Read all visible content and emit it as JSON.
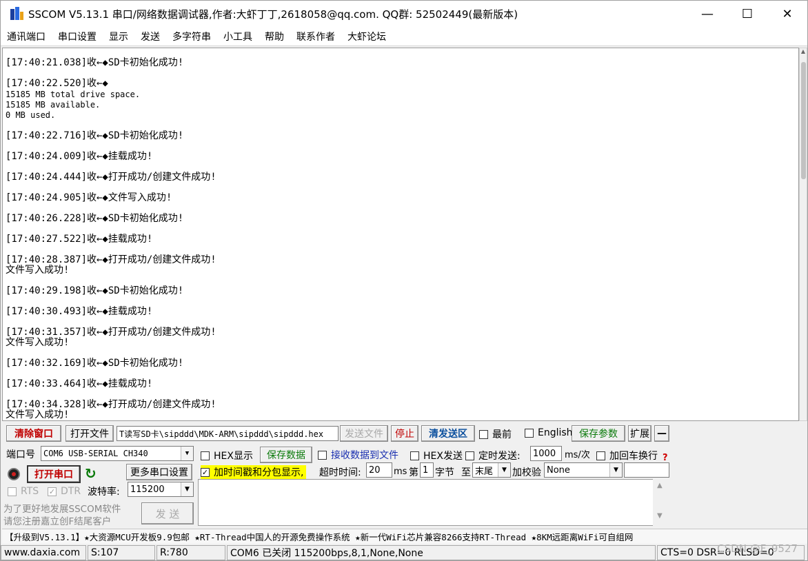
{
  "window": {
    "title": "SSCOM V5.13.1 串口/网络数据调试器,作者:大虾丁丁,2618058@qq.com. QQ群: 52502449(最新版本)",
    "minimize": "—",
    "maximize": "☐",
    "close": "✕"
  },
  "menu": [
    "通讯端口",
    "串口设置",
    "显示",
    "发送",
    "多字符串",
    "小工具",
    "帮助",
    "联系作者",
    "大虾论坛"
  ],
  "receive_log": [
    {
      "text": "[17:40:21.038]收←◆SD卡初始化成功!"
    },
    {
      "text": "[17:40:22.520]收←◆"
    },
    {
      "text": "15185 MB total drive space.",
      "small": true
    },
    {
      "text": "15185 MB available.",
      "small": true
    },
    {
      "text": "0 MB  used.",
      "small": true
    },
    {
      "text": "[17:40:22.716]收←◆SD卡初始化成功!"
    },
    {
      "text": "[17:40:24.009]收←◆挂载成功!"
    },
    {
      "text": "[17:40:24.444]收←◆打开成功/创建文件成功!"
    },
    {
      "text": "[17:40:24.905]收←◆文件写入成功!"
    },
    {
      "text": "[17:40:26.228]收←◆SD卡初始化成功!"
    },
    {
      "text": "[17:40:27.522]收←◆挂载成功!"
    },
    {
      "text": "[17:40:28.387]收←◆打开成功/创建文件成功!"
    },
    {
      "text": "文件写入成功!"
    },
    {
      "text": "[17:40:29.198]收←◆SD卡初始化成功!"
    },
    {
      "text": "[17:40:30.493]收←◆挂载成功!"
    },
    {
      "text": "[17:40:31.357]收←◆打开成功/创建文件成功!"
    },
    {
      "text": "文件写入成功!"
    },
    {
      "text": "[17:40:32.169]收←◆SD卡初始化成功!"
    },
    {
      "text": "[17:40:33.464]收←◆挂载成功!"
    },
    {
      "text": "[17:40:34.328]收←◆打开成功/创建文件成功!"
    },
    {
      "text": "文件写入成功!"
    }
  ],
  "toolbar": {
    "clear_window": "清除窗口",
    "open_file": "打开文件",
    "file_path": "T读写SD卡\\sipddd\\MDK-ARM\\sipddd\\sipddd.hex",
    "send_file": "发送文件",
    "stop": "停止",
    "clear_send": "清发送区",
    "topmost": "最前",
    "english": "English",
    "save_params": "保存参数",
    "expand": "扩展",
    "collapse": "—"
  },
  "port": {
    "port_label": "端口号",
    "port_value": "COM6 USB-SERIAL CH340",
    "open_port": "打开串口",
    "more_settings": "更多串口设置",
    "rts": "RTS",
    "dtr": "DTR",
    "baud_label": "波特率:",
    "baud_value": "115200",
    "promo_line1": "为了更好地发展SSCOM软件",
    "promo_line2": "请您注册嘉立创F结尾客户",
    "send": "发 送"
  },
  "options": {
    "hex_display": "HEX显示",
    "save_data": "保存数据",
    "recv_to_file": "接收数据到文件",
    "hex_send": "HEX发送",
    "timed_send": "定时发送:",
    "interval": "1000",
    "interval_unit": "ms/次",
    "add_crlf": "加回车换行",
    "timestamp": "加时间戳和分包显示,",
    "timeout_label": "超时时间:",
    "timeout_value": "20",
    "timeout_unit": "ms",
    "di": "第",
    "byte_value": "1",
    "byte_label": "字节",
    "to": "至",
    "end_value": "末尾",
    "checksum_label": "加校验",
    "checksum_value": "None",
    "help": "?"
  },
  "ticker": "【升级到V5.13.1】★大资源MCU开发板9.9包邮 ★RT-Thread中国人的开源免费操作系统 ★新一代WiFi芯片兼容8266支持RT-Thread ★8KM远距离WiFi可自组网",
  "status": {
    "site": "www.daxia.com",
    "sent": "S:107",
    "recv": "R:780",
    "port_state": "COM6 已关闭  115200bps,8,1,None,None",
    "lines": "CTS=0 DSR=0 RLSD=0"
  },
  "watermark": "CSDN @F_9527"
}
